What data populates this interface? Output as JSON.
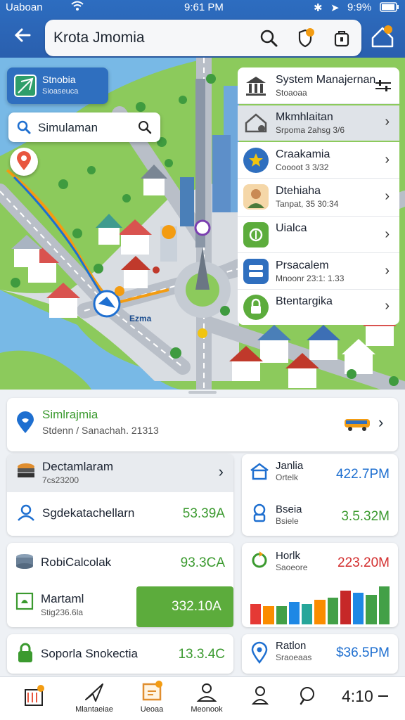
{
  "status": {
    "carrier": "Uaboan",
    "time": "9:61 PM",
    "battery": "9:9%"
  },
  "header": {
    "search_value": "Krota Jmomia"
  },
  "map": {
    "promo": {
      "title": "Stnobia",
      "subtitle": "Sioaseuca"
    },
    "search": {
      "value": "Simulaman"
    },
    "road_label": "Ezma"
  },
  "panel": {
    "items": [
      {
        "title": "System Manajernan",
        "subtitle": "Stoaoaa"
      },
      {
        "title": "Mkmhlaitan",
        "subtitle": "Srpoma 2ahsg 3/6"
      },
      {
        "title": "Craakamia",
        "subtitle": "Coooot 3 3/32"
      },
      {
        "title": "Dtehiaha",
        "subtitle": "Tanpat, 35 30:34"
      },
      {
        "title": "Uialca",
        "subtitle": ""
      },
      {
        "title": "Prsacalem",
        "subtitle": "Mnoonr 23:1: 1.33"
      },
      {
        "title": "Btentargika",
        "subtitle": ""
      }
    ]
  },
  "sheet": {
    "trip": {
      "title": "Simlrajmia",
      "subtitle": "Stdenn / Sanachah. 21313"
    },
    "left": [
      {
        "title": "Dectamlaram",
        "subtitle": "7cs23200"
      },
      {
        "title": "Sgdekatachellarn",
        "value": "53.39A"
      },
      {
        "title": "RobiCalcolak",
        "value": "93.3CA"
      },
      {
        "title": "Martaml",
        "subtitle": "Stig236.6la",
        "value": "332.10A"
      },
      {
        "title": "Soporla Snokectia",
        "value": "13.3.4C"
      }
    ],
    "right": [
      {
        "title": "Janlia",
        "subtitle": "Ortelk",
        "value": "422.7PM"
      },
      {
        "title": "Bseia",
        "subtitle": "Bsiele",
        "value": "3.5.32M"
      },
      {
        "title": "Horlk",
        "subtitle": "Saoeore",
        "value": "223.20M"
      },
      {
        "title": "Ratlon",
        "subtitle": "Sraoeaas",
        "value": "$36.5PM"
      }
    ],
    "bars": [
      {
        "value": 0.45,
        "color": "#e53935"
      },
      {
        "value": 0.4,
        "color": "#fb8c00"
      },
      {
        "value": 0.4,
        "color": "#43a047"
      },
      {
        "value": 0.5,
        "color": "#1e88e5"
      },
      {
        "value": 0.45,
        "color": "#26a69a"
      },
      {
        "value": 0.55,
        "color": "#fb8c00"
      },
      {
        "value": 0.6,
        "color": "#43a047"
      },
      {
        "value": 0.75,
        "color": "#c62828"
      },
      {
        "value": 0.7,
        "color": "#1e88e5"
      },
      {
        "value": 0.65,
        "color": "#43a047"
      },
      {
        "value": 0.85,
        "color": "#43a047"
      }
    ]
  },
  "nav": {
    "items": [
      {
        "label": "",
        "icon": "calendar-icon"
      },
      {
        "label": "Mlantaeiae",
        "icon": "arrow-icon"
      },
      {
        "label": "Ueoaa",
        "icon": "box-icon"
      },
      {
        "label": "Meonook",
        "icon": "person-icon"
      },
      {
        "label": "",
        "icon": "user-icon"
      },
      {
        "label": "",
        "icon": "search-icon"
      },
      {
        "label": "4:10",
        "icon": ""
      }
    ]
  },
  "colors": {
    "brand": "#2d6dc0",
    "accent_green": "#5cac3c",
    "map_water": "#78b9e6",
    "map_land": "#8cca5c"
  }
}
